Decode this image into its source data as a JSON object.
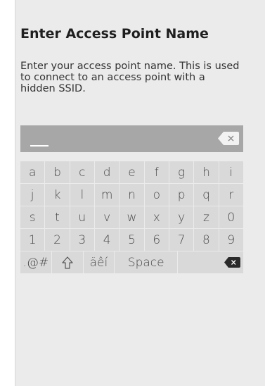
{
  "dialog": {
    "title": "Enter Access Point Name",
    "description": "Enter your access point name. This is used to connect to an access point with a hidden SSID."
  },
  "input": {
    "value": "",
    "backspace_icon": "backspace-icon"
  },
  "keyboard": {
    "rows": [
      [
        "a",
        "b",
        "c",
        "d",
        "e",
        "f",
        "g",
        "h",
        "i"
      ],
      [
        "j",
        "k",
        "l",
        "m",
        "n",
        "o",
        "p",
        "q",
        "r"
      ],
      [
        "s",
        "t",
        "u",
        "v",
        "w",
        "x",
        "y",
        "z",
        "0"
      ],
      [
        "1",
        "2",
        "3",
        "4",
        "5",
        "6",
        "7",
        "8",
        "9"
      ]
    ],
    "symbols_label": ".@#",
    "shift_icon": "shift-icon",
    "accents_label": "äêí",
    "space_label": "Space",
    "backspace_icon": "backspace-icon"
  },
  "colors": {
    "panel": "#ebebeb",
    "input_bar": "#a7a7a7",
    "key": "#d9d9d9"
  }
}
